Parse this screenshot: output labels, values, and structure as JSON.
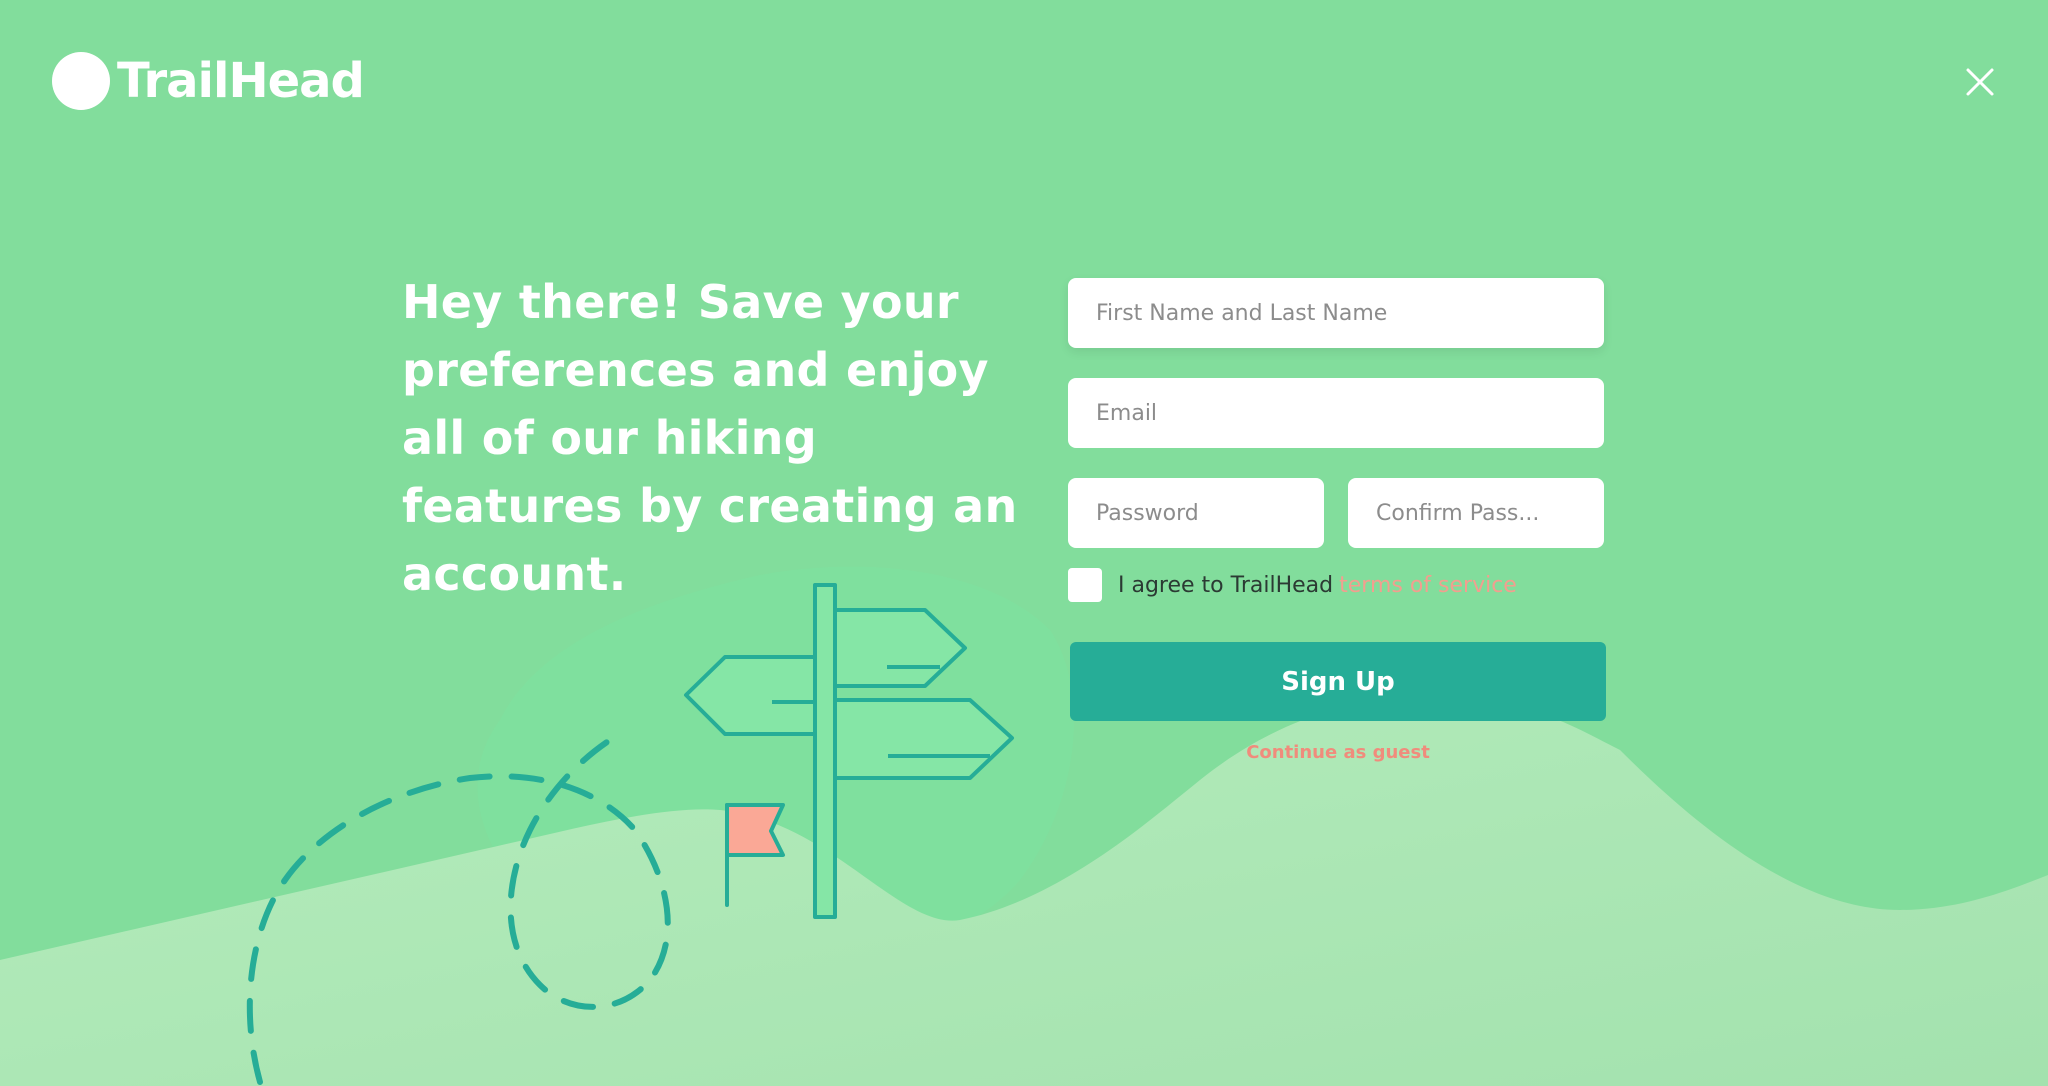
{
  "brand": {
    "name": "TrailHead"
  },
  "header": {
    "close_icon": "close-icon"
  },
  "hero": {
    "headline": "Hey there! Save your preferences and enjoy all of our hiking features by creating an account."
  },
  "form": {
    "name_placeholder": "First Name and Last Name",
    "email_placeholder": "Email",
    "password_placeholder": "Password",
    "confirm_placeholder": "Confirm Pass...",
    "agree_label": "I agree to TrailHead",
    "tos_link": "terms of service",
    "signup_label": "Sign Up",
    "guest_label": "Continue as guest"
  },
  "colors": {
    "background": "#82DD9C",
    "accent": "#26AD97",
    "link": "#F29F8F",
    "flag": "#FAA896",
    "hill": "#B2EBBA"
  },
  "icons": {
    "logo": "circle-logo-icon",
    "signpost": "signpost-icon",
    "flag": "flag-icon",
    "trail": "dashed-trail-path"
  }
}
